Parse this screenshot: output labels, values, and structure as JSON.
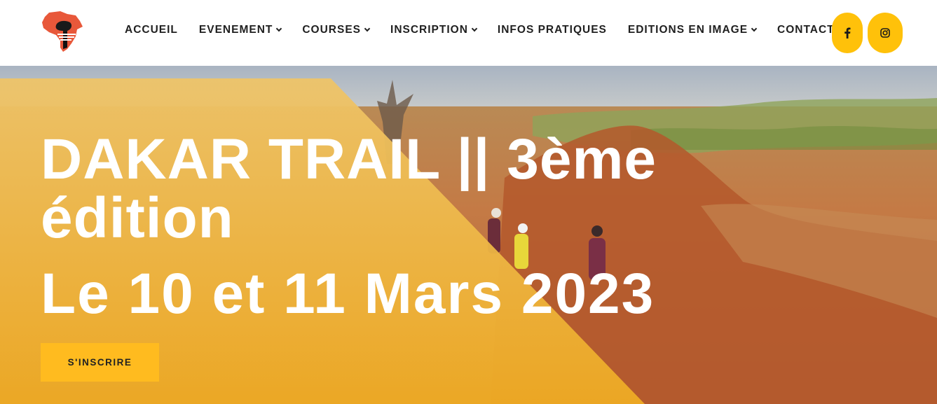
{
  "logo": {
    "icon": "africa-map-logo"
  },
  "nav": {
    "items": [
      {
        "label": "ACCUEIL",
        "dropdown": false
      },
      {
        "label": "EVENEMENT",
        "dropdown": true
      },
      {
        "label": "COURSES",
        "dropdown": true
      },
      {
        "label": "INSCRIPTION",
        "dropdown": true
      },
      {
        "label": "INFOS PRATIQUES",
        "dropdown": false
      },
      {
        "label": "EDITIONS EN IMAGE",
        "dropdown": true
      },
      {
        "label": "CONTACT",
        "dropdown": false
      }
    ]
  },
  "social": {
    "facebook_icon": "facebook-icon",
    "instagram_icon": "instagram-icon"
  },
  "hero": {
    "title": "DAKAR TRAIL || 3ème édition",
    "date": "Le 10 et 11 Mars 2023",
    "cta_label": "S'INSCRIRE"
  },
  "colors": {
    "accent": "#ffc10a",
    "overlay": "#f2b21e",
    "text_dark": "#1f1f1f"
  }
}
